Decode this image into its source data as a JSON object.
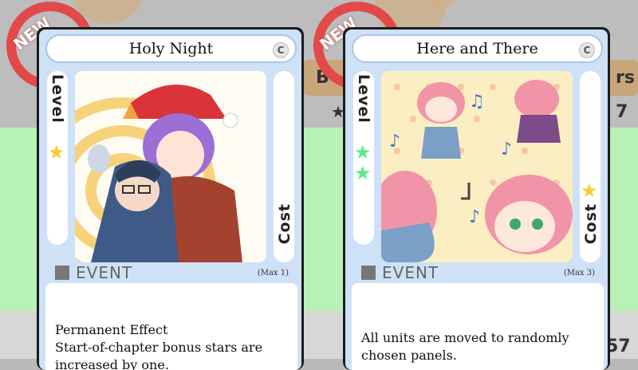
{
  "background": {
    "stat_right_top": "7",
    "stat_right_bottom": "57",
    "partial_text_left": "B",
    "partial_text_right": "rs"
  },
  "cards": [
    {
      "badge": "NEW",
      "title": "Holy Night",
      "rarity": "C",
      "level_label": "Level",
      "cost_label": "Cost",
      "level_stars": 1,
      "level_star_color": "#f5cc32",
      "type": "EVENT",
      "max": "(Max 1)",
      "text_lines": [
        "Permanent Effect",
        "Start-of-chapter bonus stars are",
        "increased by one."
      ],
      "art_icon": "christmas-illustration"
    },
    {
      "badge": "NEW",
      "title": "Here and There",
      "rarity": "C",
      "level_label": "Level",
      "cost_label": "Cost",
      "level_stars": 2,
      "level_star_color": "#5de88c",
      "cost_star_color": "#f5cc32",
      "type": "EVENT",
      "max": "(Max 3)",
      "text_lines": [
        "All units are moved to randomly",
        "chosen panels."
      ],
      "art_icon": "cat-girls-music-illustration"
    }
  ]
}
